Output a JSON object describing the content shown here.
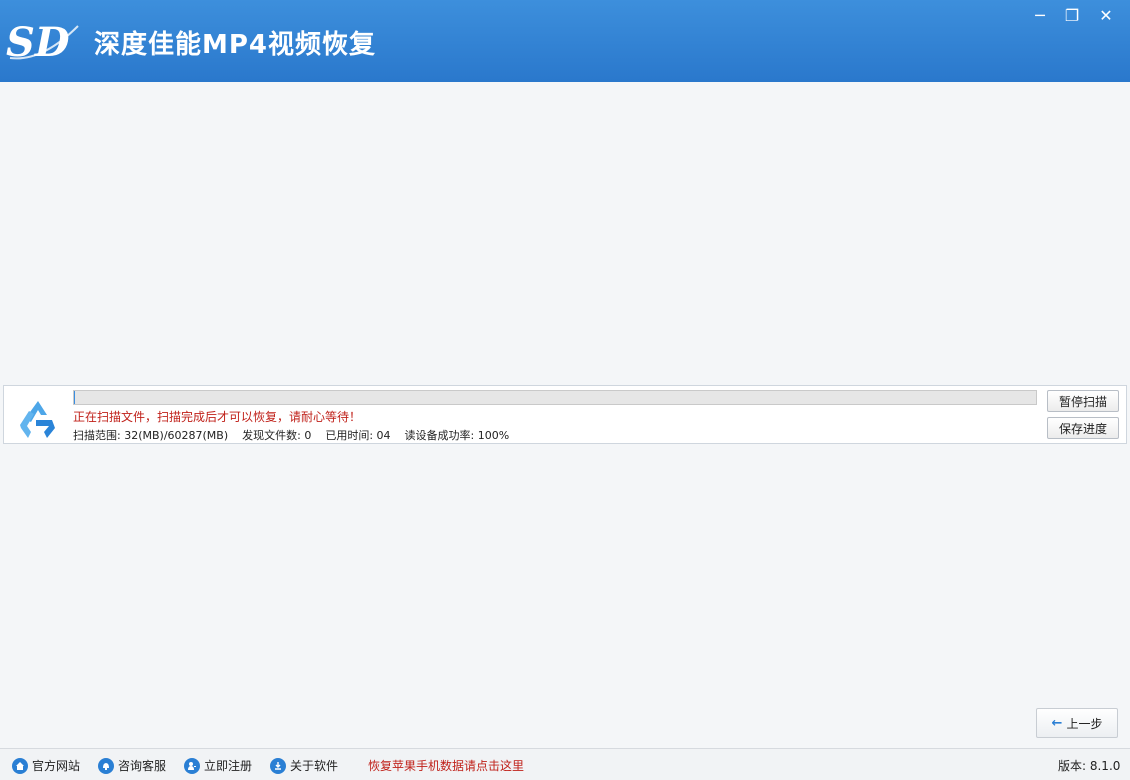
{
  "window": {
    "title": "深度佳能MP4视频恢复",
    "logo_text": "SD",
    "minimize_label": "─",
    "maximize_label": "❐",
    "close_label": "✕"
  },
  "scan": {
    "progress": 0.0005,
    "status_message": "正在扫描文件，扫描完成后才可以恢复，请耐心等待！",
    "range": "扫描范围: 32(MB)/60287(MB)",
    "found": "发现文件数: 0",
    "elapsed": "已用时间: 04",
    "read_rate": "读设备成功率: 100%",
    "pause_label": "暂停扫描",
    "save_label": "保存进度"
  },
  "nav": {
    "back_label": "上一步",
    "back_icon": "arrow-left-icon"
  },
  "statusbar": {
    "links": [
      {
        "label": "官方网站",
        "icon": "home-icon"
      },
      {
        "label": "咨询客服",
        "icon": "support-icon"
      },
      {
        "label": "立即注册",
        "icon": "user-add-icon"
      },
      {
        "label": "关于软件",
        "icon": "info-icon"
      }
    ],
    "apple_link": "恢复苹果手机数据请点击这里",
    "version": "版本: 8.1.0"
  },
  "colors": {
    "titlebar": "#2a78cc",
    "accent": "#2a7fd4",
    "warning_text": "#c0211a"
  }
}
